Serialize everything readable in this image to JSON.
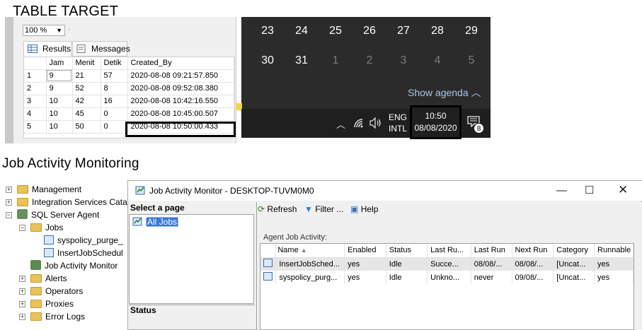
{
  "headings": {
    "table_target": "TABLE TARGET",
    "job_activity": "Job Activity Monitoring"
  },
  "ssms": {
    "zoom": "100 %",
    "tabs": {
      "results": "Results",
      "messages": "Messages"
    },
    "columns": [
      "",
      "Jam",
      "Menit",
      "Detik",
      "Created_By"
    ],
    "rows": [
      [
        "1",
        "9",
        "21",
        "57",
        "2020-08-08 09:21:57.850"
      ],
      [
        "2",
        "9",
        "52",
        "8",
        "2020-08-08 09:52:08.380"
      ],
      [
        "3",
        "10",
        "42",
        "16",
        "2020-08-08 10:42:16.550"
      ],
      [
        "4",
        "10",
        "45",
        "0",
        "2020-08-08 10:45:00.507"
      ],
      [
        "5",
        "10",
        "50",
        "0",
        "2020-08-08 10:50:00.433"
      ]
    ]
  },
  "calendar": {
    "row1": [
      "23",
      "24",
      "25",
      "26",
      "27",
      "28",
      "29"
    ],
    "row2": [
      "30",
      "31",
      "1",
      "2",
      "3",
      "4",
      "5"
    ],
    "show_agenda": "Show agenda"
  },
  "taskbar": {
    "lang1": "ENG",
    "lang2": "INTL",
    "time": "10:50",
    "date": "08/08/2020",
    "notif_count": "8"
  },
  "tree": {
    "management": "Management",
    "integration": "Integration Services Cata",
    "agent": "SQL Server Agent",
    "jobs": "Jobs",
    "job1": "syspolicy_purge_",
    "job2": "InsertJobSchedul",
    "jam": "Job Activity Monitor",
    "alerts": "Alerts",
    "operators": "Operators",
    "proxies": "Proxies",
    "errorlogs": "Error Logs"
  },
  "dialog": {
    "title": "Job Activity Monitor - DESKTOP-TUVM0M0",
    "select_page": "Select a page",
    "all_jobs": "All Jobs",
    "status": "Status",
    "refresh": "Refresh",
    "filter": "Filter ...",
    "help": "Help",
    "agent_label": "Agent Job Activity:",
    "columns": [
      "Name",
      "Enabled",
      "Status",
      "Last Ru...",
      "Last Run",
      "Next Run",
      "Category",
      "Runnable"
    ],
    "jobs": [
      [
        "InsertJobSched...",
        "yes",
        "Idle",
        "Succe...",
        "08/08/...",
        "08/08/...",
        "[Uncat...",
        "yes"
      ],
      [
        "syspolicy_purg...",
        "yes",
        "Idle",
        "Unkno...",
        "never",
        "09/08/...",
        "[Uncat...",
        "yes"
      ]
    ]
  }
}
